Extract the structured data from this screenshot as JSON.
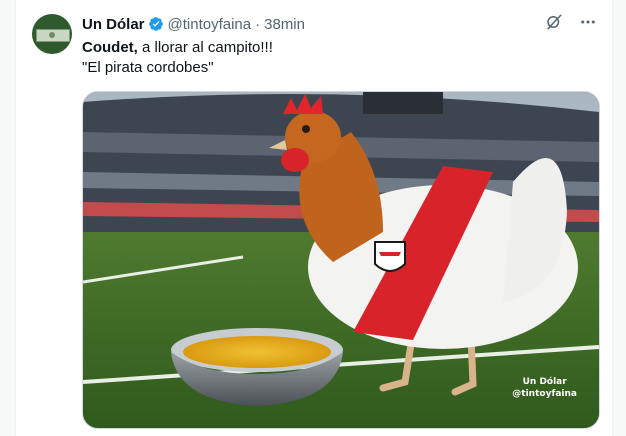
{
  "tweet": {
    "author_name": "Un Dólar",
    "handle": "@tintoyfaina",
    "separator": "·",
    "time": "38min",
    "text_bold": "Coudet,",
    "text_rest": " a llorar al campito!!!",
    "text_line2": "\"El pirata cordobes\""
  },
  "media": {
    "watermark_line1": "Un Dólar",
    "watermark_line2": "@tintoyfaina"
  },
  "icons": {
    "verified": "verified-badge-icon",
    "grok": "grok-icon",
    "more": "more-icon"
  },
  "colors": {
    "verified": "#1d9bf0",
    "secondary_text": "#536471",
    "jersey_band": "#d8232a"
  }
}
